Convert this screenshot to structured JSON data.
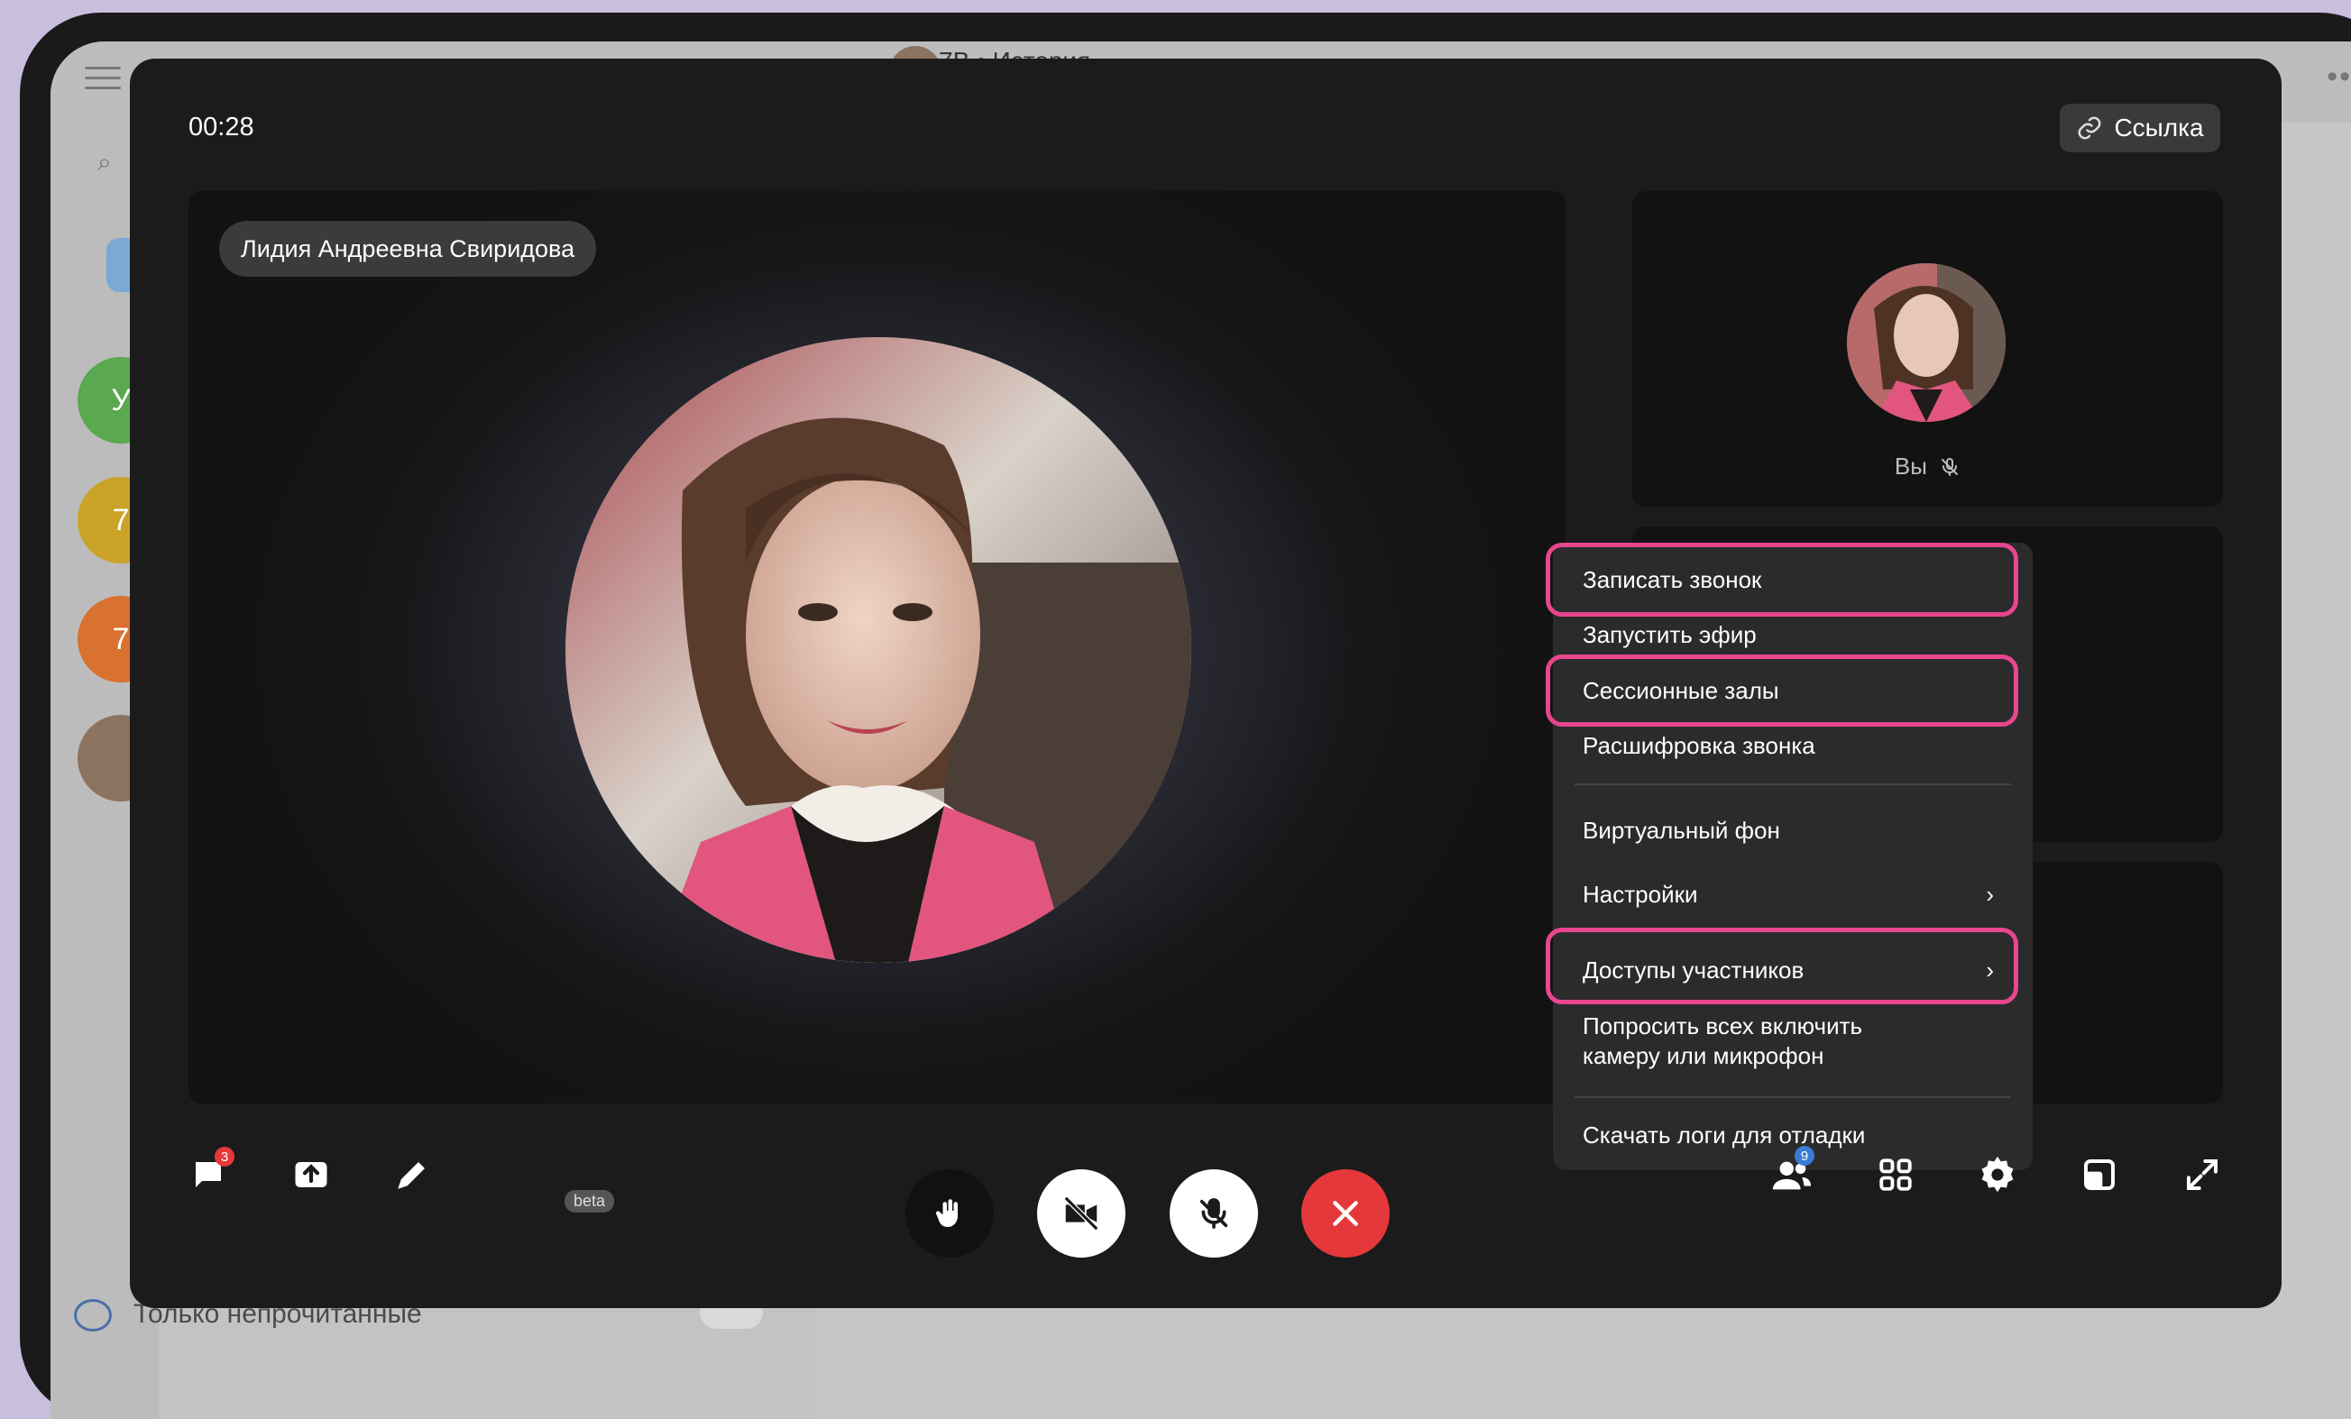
{
  "background_app": {
    "chat_title": "7В • История",
    "bottom_filter": "Только непрочитанные",
    "avatars": [
      "У",
      "7",
      "7"
    ]
  },
  "call": {
    "timer": "00:28",
    "link_button": "Ссылка",
    "speaker_name": "Лидия Андреевна Свиридова",
    "self_label": "Вы"
  },
  "menu": {
    "items": [
      {
        "label": "Записать звонок",
        "highlighted": true
      },
      {
        "label": "Запустить эфир",
        "highlighted": false
      },
      {
        "label": "Сессионные залы",
        "highlighted": true
      },
      {
        "label": "Расшифровка звонка",
        "highlighted": false
      },
      {
        "label": "Виртуальный фон",
        "highlighted": false
      },
      {
        "label": "Настройки",
        "highlighted": false,
        "submenu": true
      },
      {
        "label": "Доступы участников",
        "highlighted": true,
        "submenu": true
      },
      {
        "label_line1": "Попросить всех включить",
        "label_line2": "камеру или микрофон",
        "highlighted": false
      },
      {
        "label": "Скачать логи для отладки",
        "highlighted": false
      }
    ],
    "highlight_color": "#e8468f"
  },
  "toolbar": {
    "chat_badge": "3",
    "participants_badge": "9",
    "draw_tag": "beta",
    "end_call_color": "#e5383b"
  }
}
